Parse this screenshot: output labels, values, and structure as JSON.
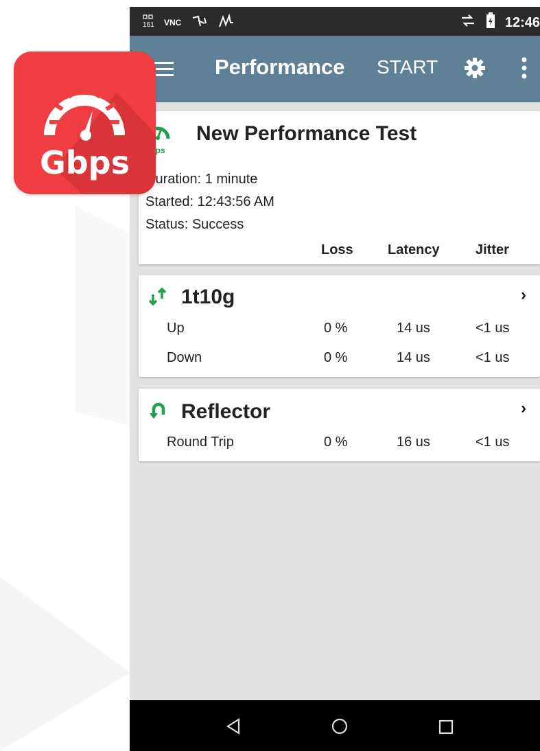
{
  "status_bar": {
    "left_icons": [
      "sim-icon",
      "vnc-icon",
      "usb-icon",
      "waveform-icon"
    ],
    "vnc_label": "VNC",
    "time": "12:46"
  },
  "app_bar": {
    "title": "Performance",
    "start_label": "START"
  },
  "app_badge": {
    "label": "Gbps",
    "color": "#ef3d42"
  },
  "summary": {
    "icon_label": "Gbps",
    "title": "New Performance Test",
    "duration": "Duration: 1 minute",
    "started": "Started: 12:43:56 AM",
    "status": "Status: Success",
    "columns": [
      "Loss",
      "Latency",
      "Jitter"
    ]
  },
  "tests": [
    {
      "name": "1t10g",
      "icon": "up-down-arrows-icon",
      "rows": [
        {
          "label": "Up",
          "loss": "0 %",
          "latency": "14 us",
          "jitter": "<1 us"
        },
        {
          "label": "Down",
          "loss": "0 %",
          "latency": "14 us",
          "jitter": "<1 us"
        }
      ]
    },
    {
      "name": "Reflector",
      "icon": "u-turn-icon",
      "rows": [
        {
          "label": "Round Trip",
          "loss": "0 %",
          "latency": "16 us",
          "jitter": "<1 us"
        }
      ]
    }
  ],
  "colors": {
    "appbar": "#5e8197",
    "accent_green": "#1aa34a",
    "badge_red": "#ef3d42"
  }
}
